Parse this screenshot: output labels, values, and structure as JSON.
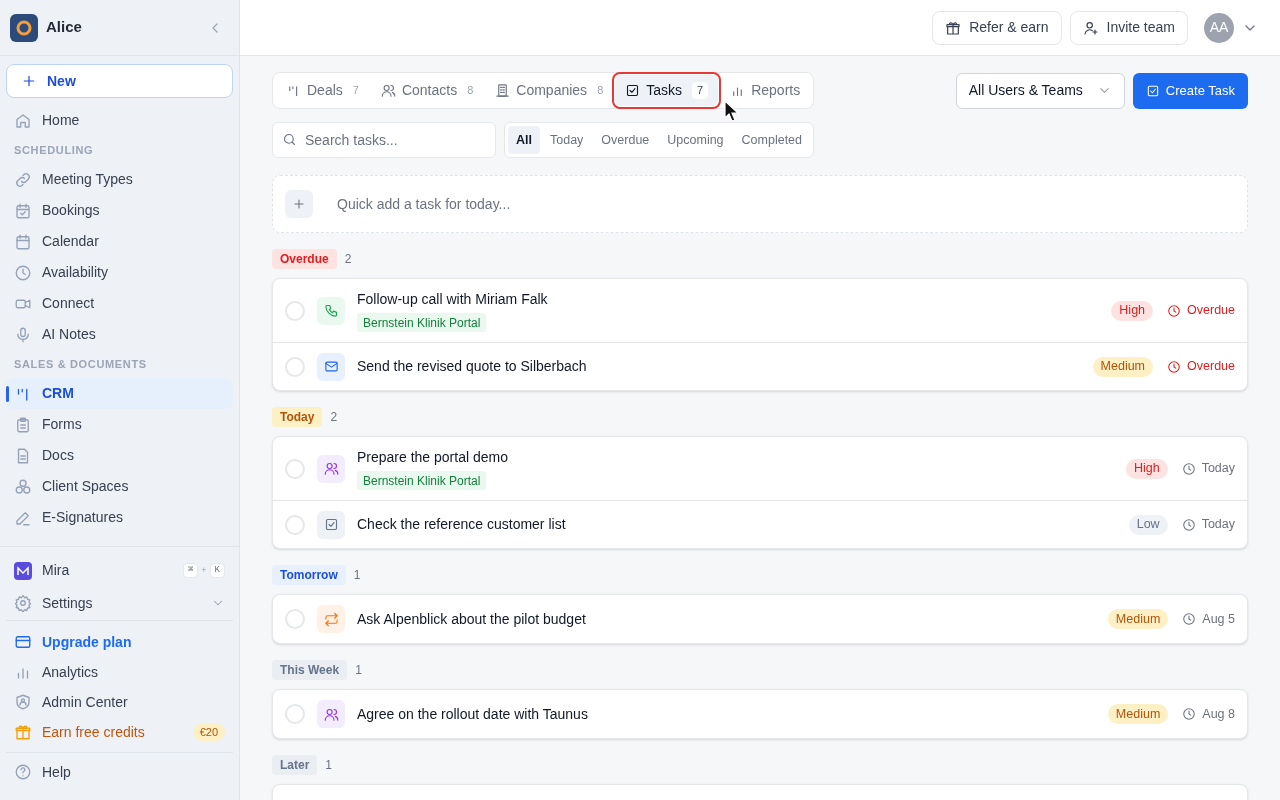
{
  "workspace": {
    "name": "Alice"
  },
  "sidebar": {
    "new_button": "New",
    "sections": [
      {
        "items": [
          {
            "label": "Home",
            "selected": false
          }
        ]
      },
      {
        "heading": "SCHEDULING",
        "items": [
          {
            "label": "Meeting Types",
            "selected": false
          },
          {
            "label": "Bookings",
            "selected": false
          },
          {
            "label": "Calendar",
            "selected": false
          },
          {
            "label": "Availability",
            "selected": false
          },
          {
            "label": "Connect",
            "selected": false
          },
          {
            "label": "AI Notes",
            "selected": false
          }
        ]
      },
      {
        "heading": "SALES & DOCUMENTS",
        "items": [
          {
            "label": "CRM",
            "selected": true
          },
          {
            "label": "Forms",
            "selected": false
          },
          {
            "label": "Docs",
            "selected": false
          },
          {
            "label": "Client Spaces",
            "selected": false
          },
          {
            "label": "E-Signatures",
            "selected": false
          }
        ]
      }
    ],
    "assistant": {
      "label": "Mira",
      "shortcut": [
        "⌘",
        "+",
        "K"
      ]
    },
    "settings": {
      "label": "Settings",
      "expanded": false
    },
    "footer": [
      {
        "label": "Upgrade plan",
        "kind": "upgrade"
      },
      {
        "label": "Analytics",
        "kind": "link"
      },
      {
        "label": "Admin Center",
        "kind": "link"
      },
      {
        "label": "Earn free credits",
        "kind": "promo",
        "badge": "€20"
      }
    ],
    "help": "Help"
  },
  "header": {
    "refer": "Refer & earn",
    "invite": "Invite team",
    "avatar": "AA"
  },
  "tabs": [
    {
      "label": "Deals",
      "count": "7",
      "selected": false
    },
    {
      "label": "Contacts",
      "count": "8",
      "selected": false
    },
    {
      "label": "Companies",
      "count": "8",
      "selected": false
    },
    {
      "label": "Tasks",
      "count": "7",
      "selected": true,
      "highlighted": true
    },
    {
      "label": "Reports",
      "selected": false
    }
  ],
  "owner_filter": "All Users & Teams",
  "create_button": "Create Task",
  "search": {
    "placeholder": "Search tasks..."
  },
  "filters": [
    {
      "label": "All",
      "selected": true
    },
    {
      "label": "Today",
      "selected": false
    },
    {
      "label": "Overdue",
      "selected": false
    },
    {
      "label": "Upcoming",
      "selected": false
    },
    {
      "label": "Completed",
      "selected": false
    }
  ],
  "quick_add": {
    "placeholder": "Quick add a task for today..."
  },
  "groups": [
    {
      "label": "Overdue",
      "kind": "overdue",
      "count": "2",
      "tasks": [
        {
          "title": "Follow-up call with Miriam Falk",
          "kind": "call",
          "tag": "Bernstein Klinik Portal",
          "priority": "High",
          "due": "Overdue",
          "overdue": true,
          "checked": false
        },
        {
          "title": "Send the revised quote to Silberbach",
          "kind": "email",
          "priority": "Medium",
          "due": "Overdue",
          "overdue": true,
          "checked": false
        }
      ]
    },
    {
      "label": "Today",
      "kind": "today",
      "count": "2",
      "tasks": [
        {
          "title": "Prepare the portal demo",
          "kind": "meeting",
          "tag": "Bernstein Klinik Portal",
          "priority": "High",
          "due": "Today",
          "overdue": false,
          "checked": false
        },
        {
          "title": "Check the reference customer list",
          "kind": "todo",
          "priority": "Low",
          "due": "Today",
          "overdue": false,
          "checked": false
        }
      ]
    },
    {
      "label": "Tomorrow",
      "kind": "tomorrow",
      "count": "1",
      "tasks": [
        {
          "title": "Ask Alpenblick about the pilot budget",
          "kind": "followup",
          "priority": "Medium",
          "due": "Aug 5",
          "overdue": false,
          "checked": false
        }
      ]
    },
    {
      "label": "This Week",
      "kind": "week",
      "count": "1",
      "tasks": [
        {
          "title": "Agree on the rollout date with Taunus",
          "kind": "meeting",
          "priority": "Medium",
          "due": "Aug 8",
          "overdue": false,
          "checked": false
        }
      ]
    },
    {
      "label": "Later",
      "kind": "later",
      "count": "1"
    }
  ]
}
